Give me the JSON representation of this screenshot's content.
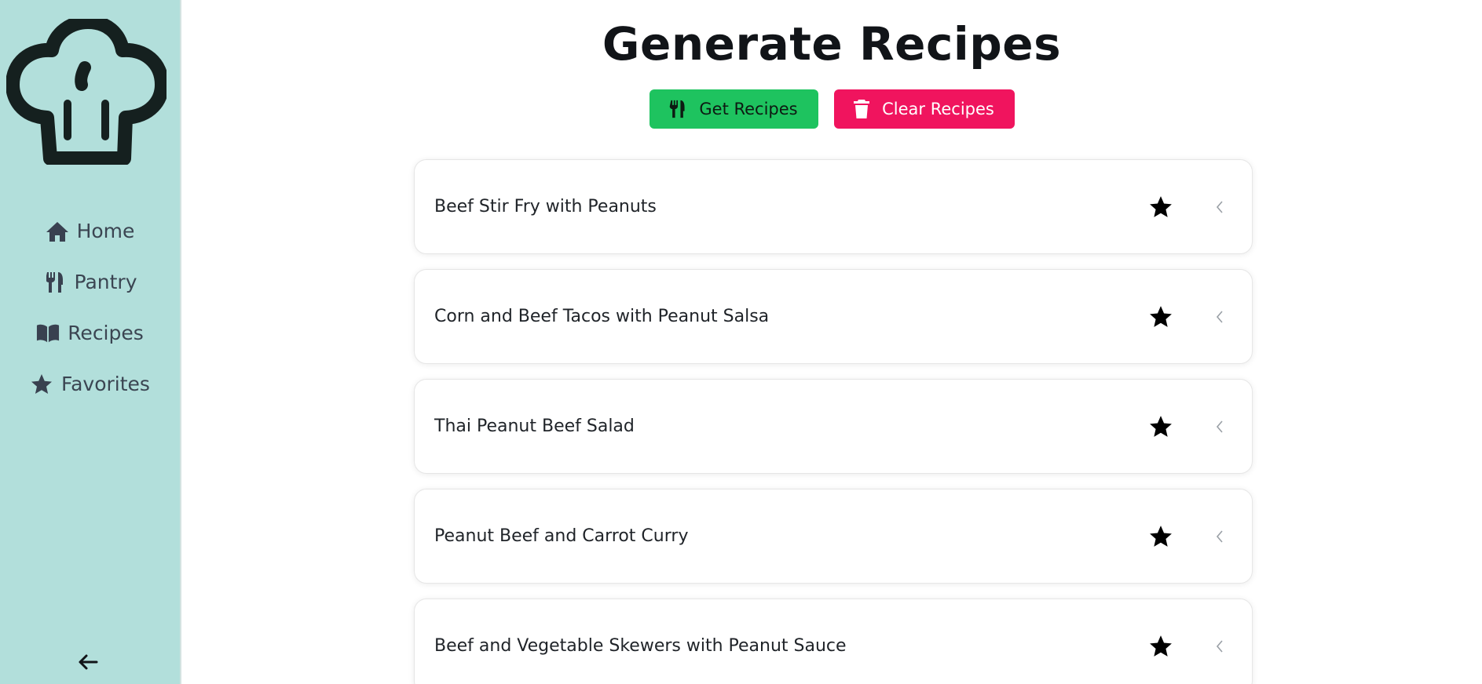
{
  "sidebar": {
    "nav": [
      {
        "label": "Home",
        "icon": "home-icon"
      },
      {
        "label": "Pantry",
        "icon": "utensils-icon"
      },
      {
        "label": "Recipes",
        "icon": "book-icon"
      },
      {
        "label": "Favorites",
        "icon": "star-icon"
      }
    ],
    "collapse_icon": "arrow-left-icon",
    "logo_icon": "chef-hat-icon",
    "background": "#b2dfdb"
  },
  "main": {
    "title": "Generate Recipes",
    "get_button": {
      "label": "Get Recipes",
      "icon": "utensils-icon",
      "color": "#1ec35f"
    },
    "clear_button": {
      "label": "Clear Recipes",
      "icon": "trash-icon",
      "color": "#f0145e"
    },
    "recipes": [
      {
        "title": "Beef Stir Fry with Peanuts"
      },
      {
        "title": "Corn and Beef Tacos with Peanut Salsa"
      },
      {
        "title": "Thai Peanut Beef Salad"
      },
      {
        "title": "Peanut Beef and Carrot Curry"
      },
      {
        "title": "Beef and Vegetable Skewers with Peanut Sauce"
      }
    ]
  }
}
